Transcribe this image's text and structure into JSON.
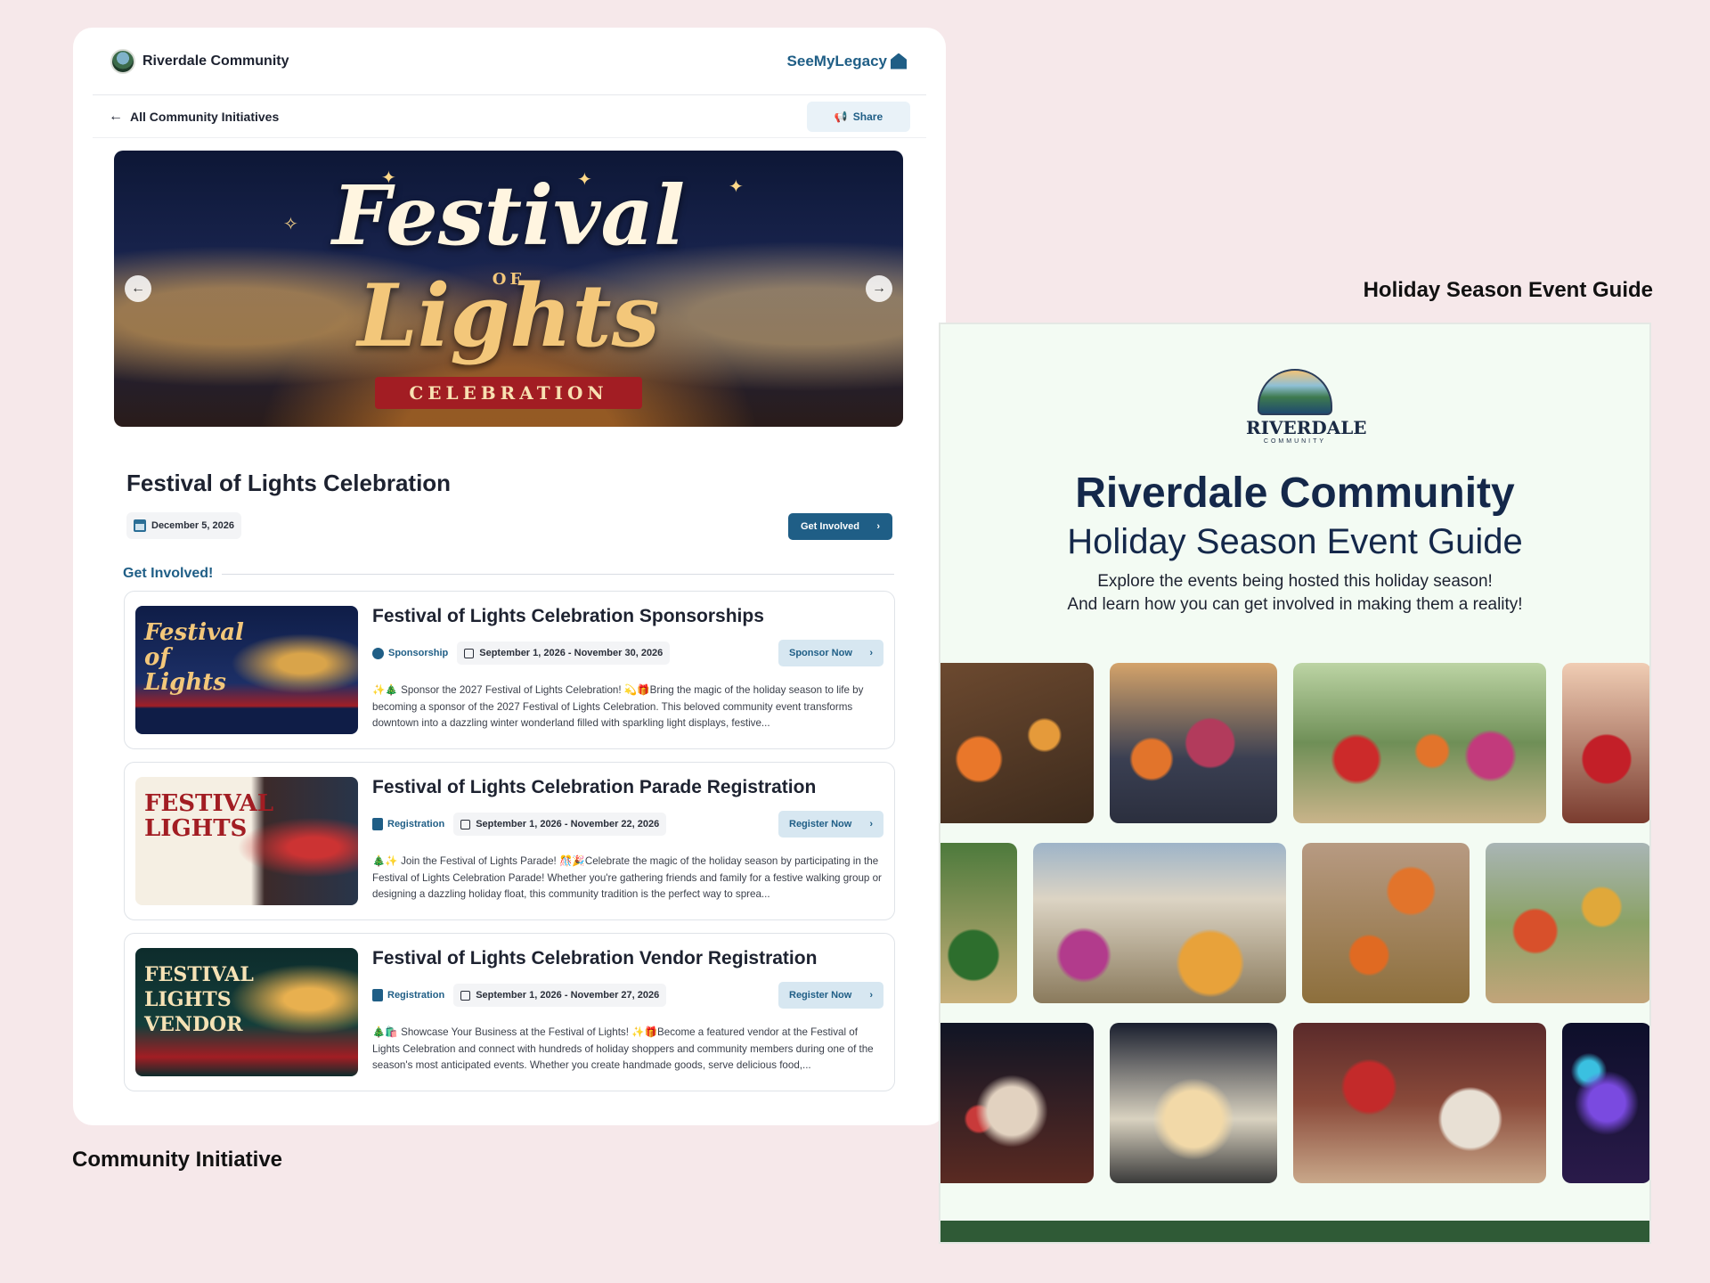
{
  "captions": {
    "left": "Community Initiative",
    "right": "Holiday Season Event Guide"
  },
  "header": {
    "community_name": "Riverdale Community",
    "partner_brand": "SeeMyLegacy",
    "back_link": "All Community Initiatives",
    "share_label": "Share"
  },
  "hero": {
    "title_line1": "Festival",
    "title_of": "OF",
    "title_line2": "Lights",
    "ribbon": "CELEBRATION"
  },
  "event": {
    "title": "Festival of Lights Celebration",
    "date": "December 5, 2026",
    "cta_label": "Get Involved"
  },
  "section": {
    "heading": "Get Involved!"
  },
  "opportunities": [
    {
      "title": "Festival of Lights Celebration Sponsorships",
      "tag": "Sponsorship",
      "range": "September 1, 2026 - November 30, 2026",
      "button": "Sponsor Now",
      "description": "✨🎄 Sponsor the 2027 Festival of Lights Celebration! 💫🎁Bring the magic of the holiday season to life by becoming a sponsor of the 2027 Festival of Lights Celebration. This beloved community event transforms downtown into a dazzling winter wonderland filled with sparkling light displays, festive...",
      "thumb_text": "Festival of Lights"
    },
    {
      "title": "Festival of Lights Celebration Parade Registration",
      "tag": "Registration",
      "range": "September 1, 2026 - November 22, 2026",
      "button": "Register Now",
      "description": "🎄✨ Join the Festival of Lights Parade! 🎊🎉Celebrate the magic of the holiday season by participating in the Festival of Lights Celebration Parade! Whether you're gathering friends and family for a festive walking group or designing a dazzling holiday float, this community tradition is the perfect way to sprea...",
      "thumb_text": "FESTIVAL LIGHTS"
    },
    {
      "title": "Festival of Lights Celebration Vendor Registration",
      "tag": "Registration",
      "range": "September 1, 2026 - November 27, 2026",
      "button": "Register Now",
      "description": "🎄🛍️ Showcase Your Business at the Festival of Lights! ✨🎁Become a featured vendor at the Festival of Lights Celebration and connect with hundreds of holiday shoppers and community members during one of the season's most anticipated events. Whether you create handmade goods, serve delicious food,...",
      "thumb_text": "FESTIVAL LIGHTS VENDOR"
    }
  ],
  "guide": {
    "logo_word": "RIVERDALE",
    "logo_sub": "COMMUNITY",
    "title": "Riverdale Community",
    "subtitle": "Holiday Season Event Guide",
    "desc_line1": "Explore the events being hosted this holiday season!",
    "desc_line2": "And learn how you can get involved in making them a reality!"
  },
  "colors": {
    "accent": "#1f5e86",
    "background": "#f6e8ea",
    "guide_background": "#f3fbf3",
    "guide_footer": "#2f5a36"
  }
}
